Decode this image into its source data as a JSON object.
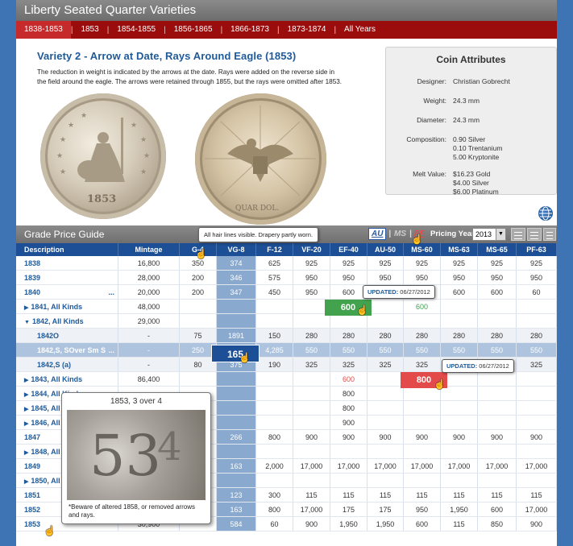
{
  "header": {
    "title": "Liberty Seated Quarter Varieties"
  },
  "year_tabs": [
    "1838-1853",
    "1853",
    "1854-1855",
    "1856-1865",
    "1866-1873",
    "1873-1874",
    "All Years"
  ],
  "variety": {
    "title": "Variety 2 - Arrow at Date, Rays Around Eagle (1853)",
    "description": "The reduction in weight is indicated by the arrows at the date. Rays were added on the reverse side in the field around the eagle. The arrows were retained through 1855, but the rays were omitted after 1853.",
    "obverse_date": "1853",
    "reverse_legend": "QUAR DOL."
  },
  "attributes": {
    "title": "Coin Attributes",
    "items": [
      {
        "label": "Designer:",
        "values": [
          "Christian Gobrecht"
        ]
      },
      {
        "label": "Weight:",
        "values": [
          "24.3 mm"
        ]
      },
      {
        "label": "Diameter:",
        "values": [
          "24.3 mm"
        ]
      },
      {
        "label": "Composition:",
        "values": [
          "0.90 Silver",
          "0.10 Trentanium",
          "5.00 Kryptonite"
        ]
      },
      {
        "label": "Melt Value:",
        "values": [
          "$16.23 Gold",
          "$4.00 Silver",
          "$6.00 Platinum"
        ]
      }
    ]
  },
  "price_guide": {
    "title": "Grade Price Guide",
    "grade_toggle": {
      "au": "AU",
      "ms": "MS",
      "pf": "PF"
    },
    "pricing_year_label": "Pricing Year",
    "pricing_year": "2013",
    "columns": [
      "Description",
      "Mintage",
      "G-4",
      "VG-8",
      "F-12",
      "VF-20",
      "EF-40",
      "AU-50",
      "MS-60",
      "MS-63",
      "MS-65",
      "PF-63"
    ],
    "rows": [
      {
        "cells": [
          "1838",
          "16,800",
          "350",
          "374",
          "625",
          "925",
          "925",
          "925",
          "925",
          "925",
          "925",
          "925"
        ]
      },
      {
        "cells": [
          "1839",
          "28,000",
          "200",
          "346",
          "575",
          "950",
          "950",
          "950",
          "950",
          "950",
          "950",
          "950"
        ]
      },
      {
        "cells": [
          "1840",
          "20,000",
          "200",
          "347",
          "450",
          "950",
          "600",
          "600",
          "600",
          "600",
          "600",
          "60"
        ],
        "more": "..."
      },
      {
        "cells": [
          "1841, All Kinds",
          "48,000",
          "",
          "",
          "",
          "",
          "",
          "",
          "600",
          "",
          "",
          ""
        ],
        "toggle": "▶",
        "green": 8
      },
      {
        "cells": [
          "1842, All Kinds",
          "29,000",
          "",
          "",
          "",
          "",
          "",
          "",
          "",
          "",
          "",
          ""
        ],
        "toggle": "▼"
      },
      {
        "cells": [
          "1842O",
          "-",
          "75",
          "1891",
          "150",
          "280",
          "280",
          "280",
          "280",
          "280",
          "280",
          "280"
        ],
        "sub": true
      },
      {
        "cells": [
          "1842,S, SOver Sm S",
          "-",
          "250",
          "165",
          "4,285",
          "550",
          "550",
          "550",
          "550",
          "550",
          "550",
          "550"
        ],
        "sub": true,
        "hl": true,
        "more": "..."
      },
      {
        "cells": [
          "1842,S (a)",
          "-",
          "80",
          "375",
          "190",
          "325",
          "325",
          "325",
          "325",
          "325",
          "325",
          "325"
        ],
        "sub": true
      },
      {
        "cells": [
          "1843, All Kinds",
          "86,400",
          "",
          "",
          "",
          "",
          "600",
          "",
          "",
          "",
          "",
          ""
        ],
        "toggle": "▶",
        "red": 6
      },
      {
        "cells": [
          "1844, All Kinds",
          "",
          "",
          "",
          "",
          "",
          "800",
          "",
          "",
          "",
          "",
          ""
        ],
        "toggle": "▶"
      },
      {
        "cells": [
          "1845, All Kinds",
          "",
          "",
          "",
          "",
          "",
          "800",
          "",
          "",
          "",
          "",
          ""
        ],
        "toggle": "▶"
      },
      {
        "cells": [
          "1846, All Kinds",
          "",
          "",
          "",
          "",
          "",
          "900",
          "",
          "",
          "",
          "",
          ""
        ],
        "toggle": "▶"
      },
      {
        "cells": [
          "1847",
          "",
          "",
          "266",
          "800",
          "900",
          "900",
          "900",
          "900",
          "900",
          "900",
          "900"
        ]
      },
      {
        "cells": [
          "1848, All Kinds",
          "",
          "",
          "",
          "",
          "",
          "",
          "",
          "",
          "",
          "",
          ""
        ],
        "toggle": "▶"
      },
      {
        "cells": [
          "1849",
          "",
          "",
          "163",
          "2,000",
          "17,000",
          "17,000",
          "17,000",
          "17,000",
          "17,000",
          "17,000",
          "17,000"
        ]
      },
      {
        "cells": [
          "1850, All Kinds",
          "",
          "",
          "",
          "",
          "",
          "",
          "",
          "",
          "",
          "",
          ""
        ],
        "toggle": "▶"
      },
      {
        "cells": [
          "1851",
          "",
          "",
          "123",
          "300",
          "115",
          "115",
          "115",
          "115",
          "115",
          "115",
          "115"
        ]
      },
      {
        "cells": [
          "1852",
          "",
          "",
          "163",
          "800",
          "17,000",
          "175",
          "175",
          "950",
          "1,950",
          "600",
          "17,000"
        ]
      },
      {
        "cells": [
          "1853",
          "30,900",
          "",
          "584",
          "60",
          "900",
          "1,950",
          "1,950",
          "600",
          "115",
          "850",
          "900"
        ]
      }
    ],
    "hover_value": "165",
    "update_popups": [
      {
        "label": "UPDATED:",
        "date": "06/27/2012",
        "value": "600"
      },
      {
        "label": "UPDATED:",
        "date": "06/27/2012",
        "value": "800"
      }
    ],
    "grade_tooltip": "All hair lines visible. Drapery partly worn.",
    "variety_popup": {
      "title": "1853, 3 over 4",
      "note": "*Beware of altered 1858, or removed arrows and rays."
    }
  }
}
